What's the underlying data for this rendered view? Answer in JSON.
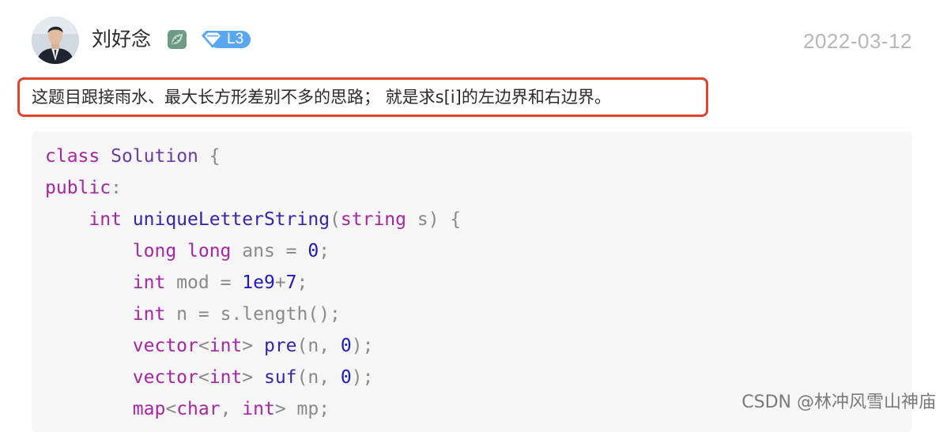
{
  "comment": {
    "username": "刘好念",
    "level": "L3",
    "date": "2022-03-12",
    "text": "这题目跟接雨水、最大长方形差别不多的思路； 就是求s[i]的左边界和右边界。"
  },
  "code_lines": [
    {
      "tokens": [
        {
          "t": "class",
          "c": "kw"
        },
        {
          "t": " ",
          "c": "tx"
        },
        {
          "t": "Solution",
          "c": "cls"
        },
        {
          "t": " {",
          "c": "pl"
        }
      ]
    },
    {
      "tokens": [
        {
          "t": "public",
          "c": "kw"
        },
        {
          "t": ":",
          "c": "pl"
        }
      ]
    },
    {
      "tokens": [
        {
          "t": "    ",
          "c": "tx"
        },
        {
          "t": "int",
          "c": "typ"
        },
        {
          "t": " ",
          "c": "tx"
        },
        {
          "t": "uniqueLetterString",
          "c": "fn"
        },
        {
          "t": "(",
          "c": "pl"
        },
        {
          "t": "string",
          "c": "typ"
        },
        {
          "t": " s) {",
          "c": "pl"
        }
      ]
    },
    {
      "tokens": [
        {
          "t": "        ",
          "c": "tx"
        },
        {
          "t": "long long",
          "c": "typ"
        },
        {
          "t": " ans = ",
          "c": "pl"
        },
        {
          "t": "0",
          "c": "num"
        },
        {
          "t": ";",
          "c": "pl"
        }
      ]
    },
    {
      "tokens": [
        {
          "t": "        ",
          "c": "tx"
        },
        {
          "t": "int",
          "c": "typ"
        },
        {
          "t": " mod = ",
          "c": "pl"
        },
        {
          "t": "1e9",
          "c": "num"
        },
        {
          "t": "+",
          "c": "pl"
        },
        {
          "t": "7",
          "c": "num"
        },
        {
          "t": ";",
          "c": "pl"
        }
      ]
    },
    {
      "tokens": [
        {
          "t": "        ",
          "c": "tx"
        },
        {
          "t": "int",
          "c": "typ"
        },
        {
          "t": " n = s.length();",
          "c": "pl"
        }
      ]
    },
    {
      "tokens": [
        {
          "t": "        ",
          "c": "tx"
        },
        {
          "t": "vector",
          "c": "typ"
        },
        {
          "t": "<",
          "c": "pl"
        },
        {
          "t": "int",
          "c": "typ"
        },
        {
          "t": "> ",
          "c": "pl"
        },
        {
          "t": "pre",
          "c": "fn"
        },
        {
          "t": "(n, ",
          "c": "pl"
        },
        {
          "t": "0",
          "c": "num"
        },
        {
          "t": ");",
          "c": "pl"
        }
      ]
    },
    {
      "tokens": [
        {
          "t": "        ",
          "c": "tx"
        },
        {
          "t": "vector",
          "c": "typ"
        },
        {
          "t": "<",
          "c": "pl"
        },
        {
          "t": "int",
          "c": "typ"
        },
        {
          "t": "> ",
          "c": "pl"
        },
        {
          "t": "suf",
          "c": "fn"
        },
        {
          "t": "(n, ",
          "c": "pl"
        },
        {
          "t": "0",
          "c": "num"
        },
        {
          "t": ");",
          "c": "pl"
        }
      ]
    },
    {
      "tokens": [
        {
          "t": "        ",
          "c": "tx"
        },
        {
          "t": "map",
          "c": "typ"
        },
        {
          "t": "<",
          "c": "pl"
        },
        {
          "t": "char",
          "c": "typ"
        },
        {
          "t": ", ",
          "c": "pl"
        },
        {
          "t": "int",
          "c": "typ"
        },
        {
          "t": "> mp;",
          "c": "pl"
        }
      ]
    }
  ],
  "watermark": "CSDN @林冲风雪山神庙",
  "colors": {
    "highlight_border": "#e0432e",
    "keyword": "#a626a4",
    "function": "#3b23a8",
    "number": "#1f1ab8"
  },
  "icons": [
    "avatar-photo",
    "leaf-badge-icon",
    "diamond-level-icon"
  ]
}
